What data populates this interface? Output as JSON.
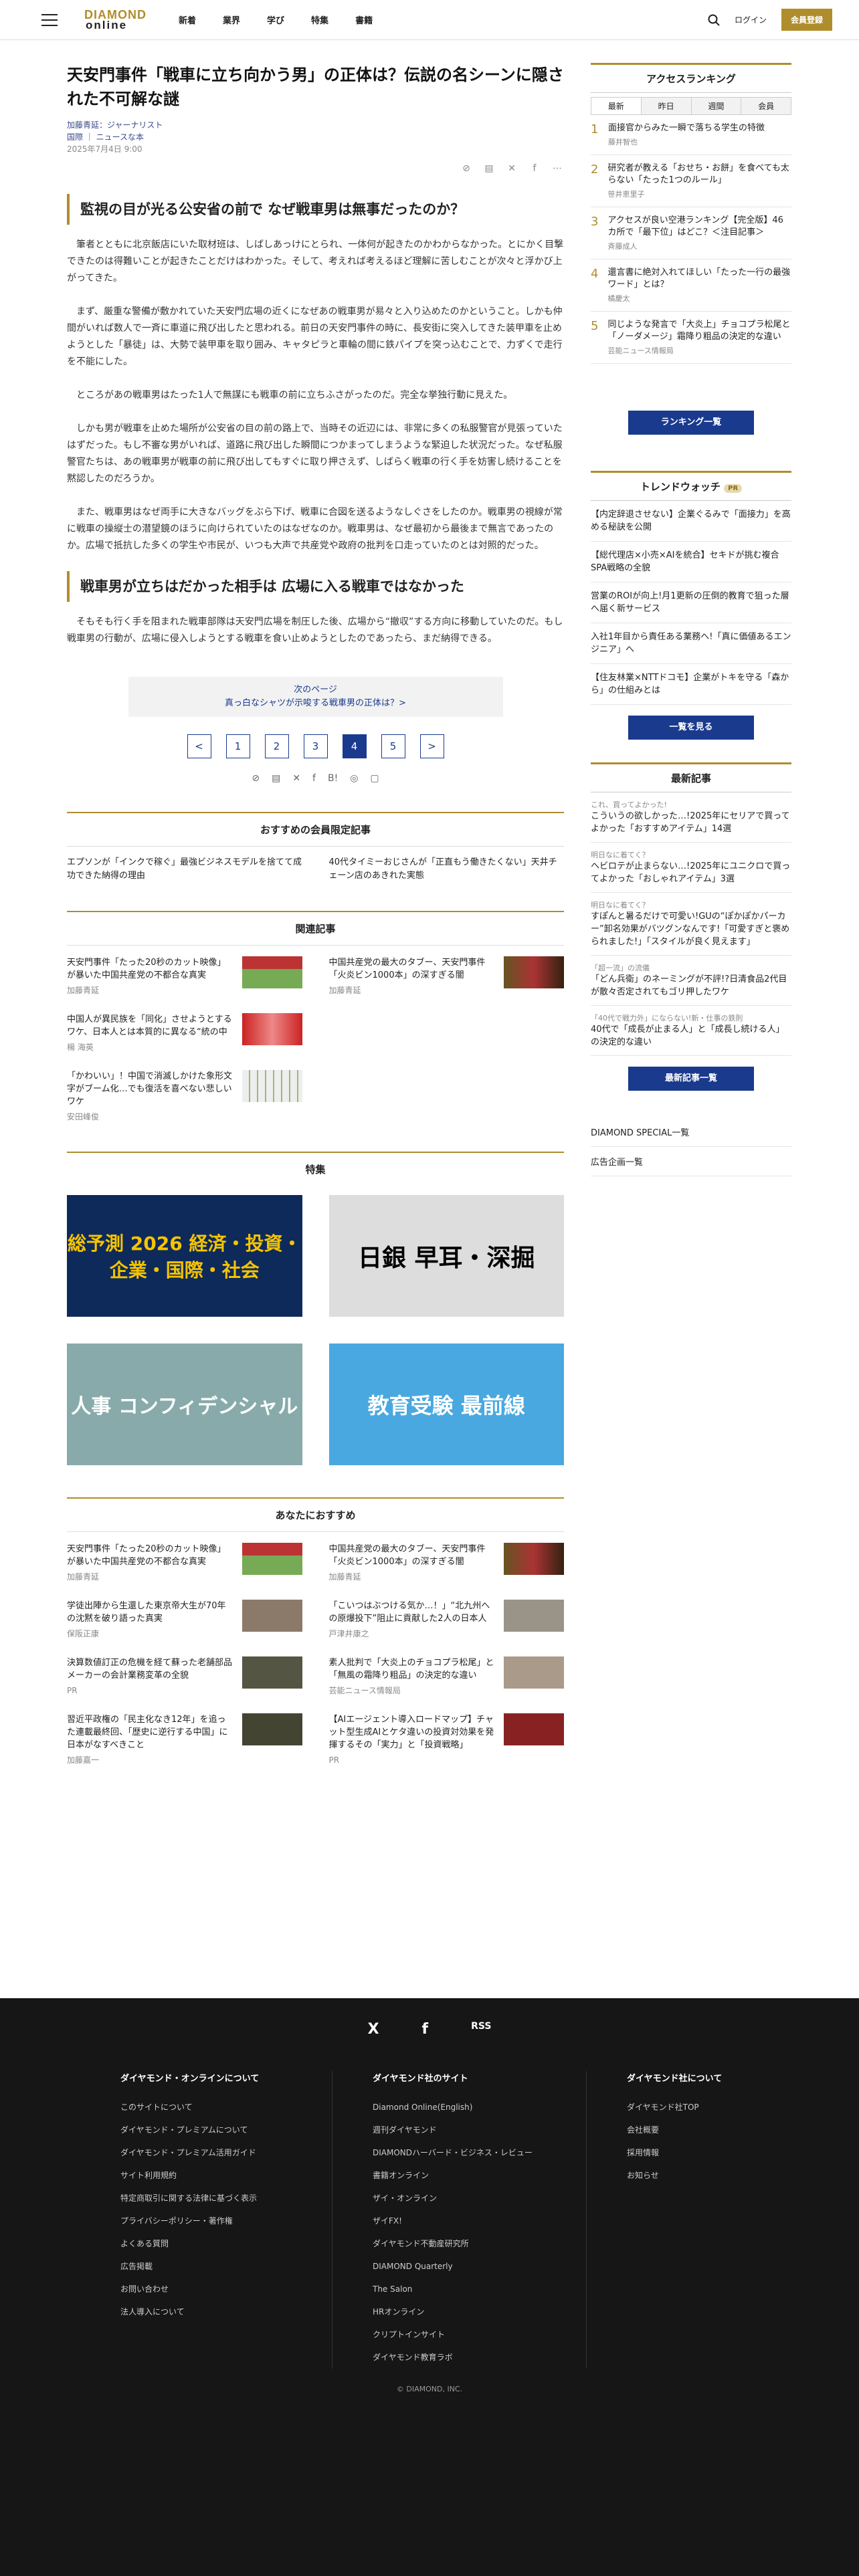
{
  "header": {
    "logo_top": "DIAMOND",
    "logo_bottom": "online",
    "nav": [
      "新着",
      "業界",
      "学び",
      "特集",
      "書籍"
    ],
    "login": "ログイン",
    "register": "会員登録"
  },
  "article": {
    "title": "天安門事件「戦車に立ち向かう男」の正体は？伝説の名シーンに隠された不可解な謎",
    "author": "加藤青延：ジャーナリスト",
    "category": "国際 ｜ ニュースな本",
    "date": "2025年7月4日 9:00",
    "h2_1": "監視の目が光る公安省の前で なぜ戦車男は無事だったのか？",
    "paras_1": [
      "筆者とともに北京飯店にいた取材班は、しばしあっけにとられ、一体何が起きたのかわからなかった。とにかく目撃できたのは得難いことが起きたことだけはわかった。そして、考えれば考えるほど理解に苦しむことが次々と浮かび上がってきた。",
      "まず、厳重な警備が敷かれていた天安門広場の近くになぜあの戦車男が易々と入り込めたのかということ。しかも仲間がいれば数人で一斉に車道に飛び出したと思われる。前日の天安門事件の時に、長安街に突入してきた装甲車を止めようとした「暴徒」は、大勢で装甲車を取り囲み、キャタピラと車輪の間に鉄パイプを突っ込むことで、力ずくで走行を不能にした。",
      "ところがあの戦車男はたった1人で無謀にも戦車の前に立ちふさがったのだ。完全な挙独行動に見えた。",
      "しかも男が戦車を止めた場所が公安省の目の前の路上で、当時その近辺には、非常に多くの私服警官が見張っていたはずだった。もし不審な男がいれば、道路に飛び出した瞬間につかまってしまうような緊迫した状況だった。なぜ私服警官たちは、あの戦車男が戦車の前に飛び出してもすぐに取り押さえず、しばらく戦車の行く手を妨害し続けることを黙認したのだろうか。",
      "また、戦車男はなぜ両手に大きなバッグをぶら下げ、戦車に合図を送るようなしぐさをしたのか。戦車男の視線が常に戦車の操縦士の潜望鏡のほうに向けられていたのはなぜなのか。戦車男は、なぜ最初から最後まで無言であったのか。広場で抵抗した多くの学生や市民が、いつも大声で共産党や政府の批判を口走っていたのとは対照的だった。"
    ],
    "h2_2": "戦車男が立ちはだかった相手は 広場に入る戦車ではなかった",
    "paras_2": [
      "そもそも行く手を阻まれた戦車部隊は天安門広場を制圧した後、広場から“撤収”する方向に移動していたのだ。もし戦車男の行動が、広場に侵入しようとする戦車を食い止めようとしたのであったら、まだ納得できる。"
    ],
    "next_label": "次のページ",
    "next_title": "真っ白なシャツが示唆する戦車男の正体は？>",
    "pages": [
      "<",
      "1",
      "2",
      "3",
      "4",
      "5",
      ">"
    ],
    "current_page": "4"
  },
  "members": {
    "heading": "おすすめの会員限定記事",
    "items": [
      "エプソンが「インクで稼ぐ」最強ビジネスモデルを捨てて成功できた納得の理由",
      "40代タイミーおじさんが「正直もう働きたくない」天井チェーン店のあきれた実態"
    ]
  },
  "related": {
    "heading": "関連記事",
    "items": [
      {
        "title": "天安門事件「たった20秒のカット映像」が暴いた中国共産党の不都合な真実",
        "author": "加藤青延"
      },
      {
        "title": "中国共産党の最大のタブー、天安門事件「火炎ビン1000本」の深すぎる闇",
        "author": "加藤青延"
      },
      {
        "title": "中国人が異民族を「同化」させようとするワケ、日本人とは本質的に異なる“統の中",
        "author": "楊 海英"
      },
      {
        "title": "「かわいい」！中国で消滅しかけた象形文字がブーム化…でも復活を喜べない悲しいワケ",
        "author": "安田峰俊"
      }
    ]
  },
  "feature": {
    "heading": "特集",
    "items": [
      "総予測 2026 経済・投資・企業・国際・社会",
      "日銀 早耳・深掘",
      "人事 コンフィデンシャル",
      "教育受験 最前線"
    ]
  },
  "recommend": {
    "heading": "あなたにおすすめ",
    "items": [
      {
        "title": "天安門事件「たった20秒のカット映像」が暴いた中国共産党の不都合な真実",
        "author": "加藤青延"
      },
      {
        "title": "中国共産党の最大のタブー、天安門事件「火炎ビン1000本」の深すぎる闇",
        "author": "加藤青延"
      },
      {
        "title": "学徒出陣から生還した東京帝大生が70年の沈黙を破り語った真実",
        "author": "保阪正康"
      },
      {
        "title": "「こいつはぶつける気か…！」“北九州への原爆投下”阻止に貢献した2人の日本人",
        "author": "戸津井康之"
      },
      {
        "title": "決算数値訂正の危機を経て蘇った老舗部品メーカーの会計業務変革の全貌",
        "author": "PR"
      },
      {
        "title": "素人批判で「大炎上のチョコプラ松尾」と「無風の霜降り粗品」の決定的な違い",
        "author": "芸能ニュース情報局"
      },
      {
        "title": "習近平政権の「民主化なき12年」を追った連載最終回、「歴史に逆行する中国」に日本がなすべきこと",
        "author": "加藤嘉一"
      },
      {
        "title": "【AIエージェント導入ロードマップ】チャット型生成AIとケタ違いの投資対効果を発揮するその「実力」と「投資戦略」",
        "author": "PR"
      }
    ]
  },
  "sidebar": {
    "ranking_heading": "アクセスランキング",
    "tabs": [
      "最新",
      "昨日",
      "週間",
      "会員"
    ],
    "ranking": [
      {
        "t": "面接官からみた一瞬で落ちる学生の特徴",
        "a": "藤井智也"
      },
      {
        "t": "研究者が教える「おせち・お餅」を食べても太らない「たった1つのルール」",
        "a": "笹井恵里子"
      },
      {
        "t": "アクセスが良い空港ランキング【完全版】46カ所で「最下位」はどこ？＜注目記事＞",
        "a": "斉藤成人"
      },
      {
        "t": "還言書に絶対入れてほしい「たった一行の最強ワード」とは？",
        "a": "橘慶太"
      },
      {
        "t": "同じような発言で「大炎上」チョコプラ松尾と「ノーダメージ」霜降り粗品の決定的な違い",
        "a": "芸能ニュース情報局"
      }
    ],
    "ranking_btn": "ランキング一覧",
    "trend_heading": "トレンドウォッチ",
    "trend_badge": "PR",
    "trends": [
      "【内定辞退させない】企業ぐるみで「面接力」を高める秘訣を公開",
      "【総代理店×小売×AIを統合】セキドが挑む複合SPA戦略の全貌",
      "営業のROIが向上!月1更新の圧倒的教育で狙った層へ届く新サービス",
      "入社1年目から責任ある業務へ!「真に価値あるエンジニア」へ",
      "【住友林業×NTTドコモ】企業がトキを守る「森から」の仕組みとは"
    ],
    "trend_btn": "一覧を見る",
    "latest_heading": "最新記事",
    "latest": [
      {
        "lab": "これ、買ってよかった!",
        "t": "こういうの欲しかった…!2025年にセリアで買ってよかった「おすすめアイテム」14選"
      },
      {
        "lab": "明日なに着てく？",
        "t": "ヘビロテが止まらない…!2025年にユニクロで買ってよかった「おしゃれアイテム」3選"
      },
      {
        "lab": "明日なに着てく？",
        "t": "すぽんと暑るだけで可愛い!GUの“ぽかぽかパーカー”卸名効果がバツグンなんです!「可愛すぎと褒められました!」「スタイルが良く見えます」"
      },
      {
        "lab": "「超一流」の流儀",
        "t": "「どん兵衛」のネーミングが不評!?日清食品2代目が散々否定されてもゴリ押したワケ"
      },
      {
        "lab": "「40代で戦力外」にならない!新・仕事の鉄則",
        "t": "40代で「成長が止まる人」と「成長し続ける人」の決定的な違い"
      }
    ],
    "latest_btn": "最新記事一覧",
    "links": [
      "DIAMOND SPECIAL一覧",
      "広告企画一覧"
    ]
  },
  "footer": {
    "social": [
      "X",
      "f",
      "RSS"
    ],
    "col1_h": "ダイヤモンド・オンラインについて",
    "col1": [
      "このサイトについて",
      "ダイヤモンド・プレミアムについて",
      "ダイヤモンド・プレミアム活用ガイド",
      "サイト利用規約",
      "特定商取引に関する法律に基づく表示",
      "プライバシーポリシー・著作権",
      "よくある質問",
      "広告掲載",
      "お問い合わせ",
      "法人導入について"
    ],
    "col2_h": "ダイヤモンド社のサイト",
    "col2": [
      "Diamond Online(English)",
      "週刊ダイヤモンド",
      "DIAMONDハーバード・ビジネス・レビュー",
      "書籍オンライン",
      "ザイ・オンライン",
      "ザイFX!",
      "ダイヤモンド不動産研究所",
      "DIAMOND Quarterly",
      "The Salon",
      "HRオンライン",
      "クリプトインサイト",
      "ダイヤモンド教育ラボ"
    ],
    "col3_h": "ダイヤモンド社について",
    "col3": [
      "ダイヤモンド社TOP",
      "会社概要",
      "採用情報",
      "お知らせ"
    ],
    "copyright": "© DIAMOND, INC."
  }
}
